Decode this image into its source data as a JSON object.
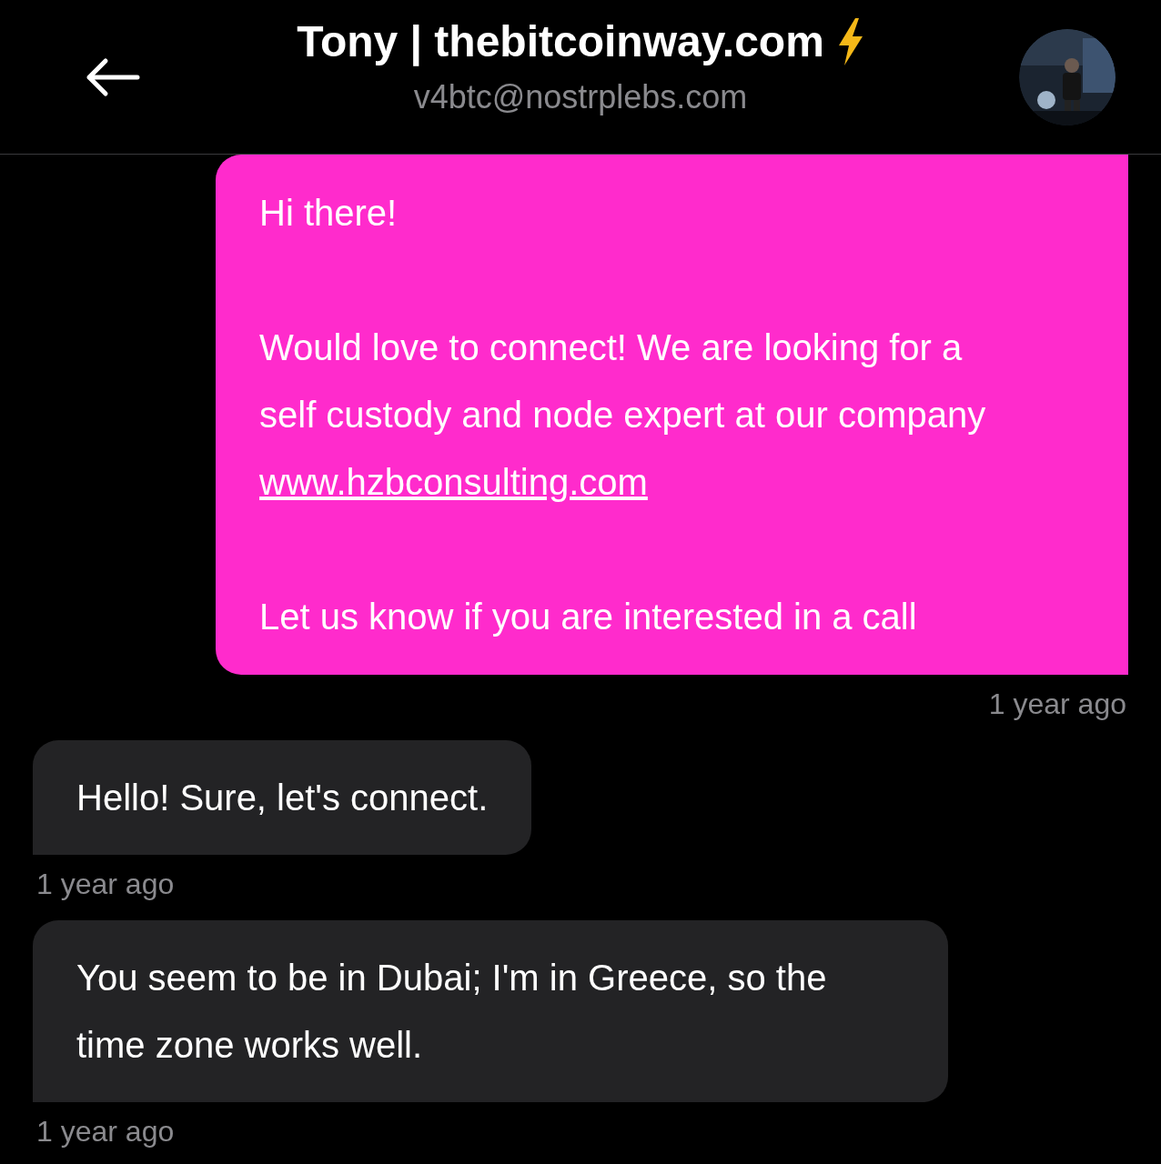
{
  "header": {
    "title": "Tony | thebitcoinway.com",
    "subtitle": "v4btc@nostrplebs.com"
  },
  "messages": [
    {
      "kind": "outgoing",
      "paragraphs": [
        {
          "text": "Hi there!"
        },
        {
          "text": "Would love to connect! We are looking for a self custody and node expert at our company",
          "link": "www.hzbconsulting.com"
        },
        {
          "text": "Let us know if you are interested in a call"
        }
      ],
      "time": "1 year ago"
    },
    {
      "kind": "incoming",
      "paragraphs": [
        {
          "text": "Hello! Sure, let's connect."
        }
      ],
      "time": "1 year ago"
    },
    {
      "kind": "incoming",
      "paragraphs": [
        {
          "text": "You seem to be in Dubai; I'm in Greece, so the time zone works well."
        }
      ],
      "time": "1 year ago"
    }
  ]
}
